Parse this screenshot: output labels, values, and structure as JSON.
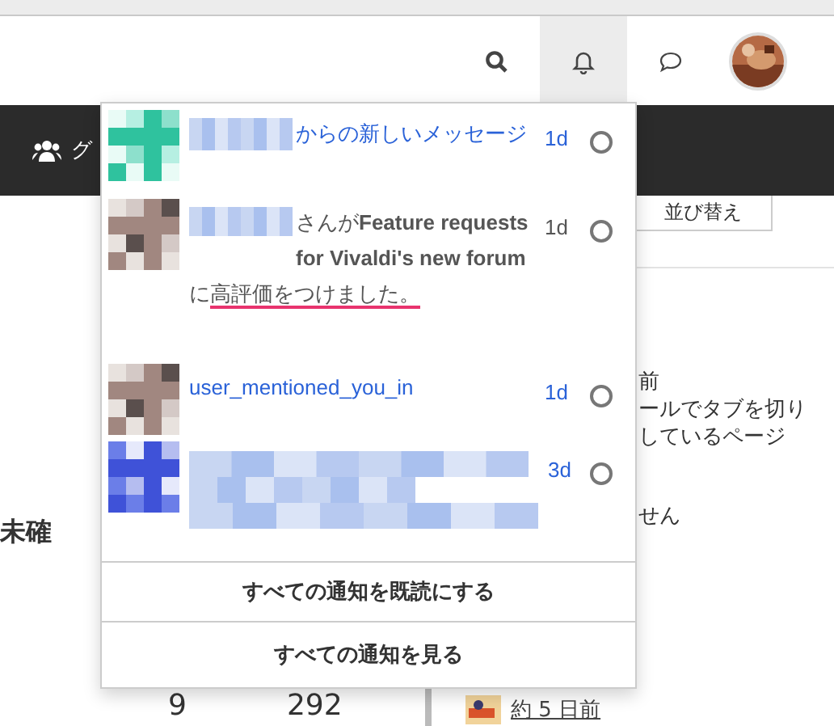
{
  "header": {
    "bell_selected": true
  },
  "nav": {
    "group_label": "グ"
  },
  "notifications": [
    {
      "kind": "link",
      "text": "からの新しいメッセージ",
      "time": "1d",
      "read": false
    },
    {
      "kind": "text",
      "text": "さんが**Feature requests for Vivaldi's new forum**に",
      "highlight": "高評価をつけました。",
      "time": "1d",
      "read": false
    },
    {
      "kind": "link",
      "text": "user_mentioned_you_in",
      "time": "1d",
      "read": false
    },
    {
      "kind": "hidden",
      "time": "3d",
      "read": false
    }
  ],
  "actions": [
    "すべての通知を既読にする",
    "すべての通知を見る"
  ],
  "background": {
    "sort_button": "並び替え",
    "left_label": "未確",
    "right_lines": [
      "前",
      "ールでタブを切り",
      "しているページ",
      "せん"
    ],
    "counts": [
      "9",
      "292"
    ],
    "post_time": "約 5 日前"
  }
}
